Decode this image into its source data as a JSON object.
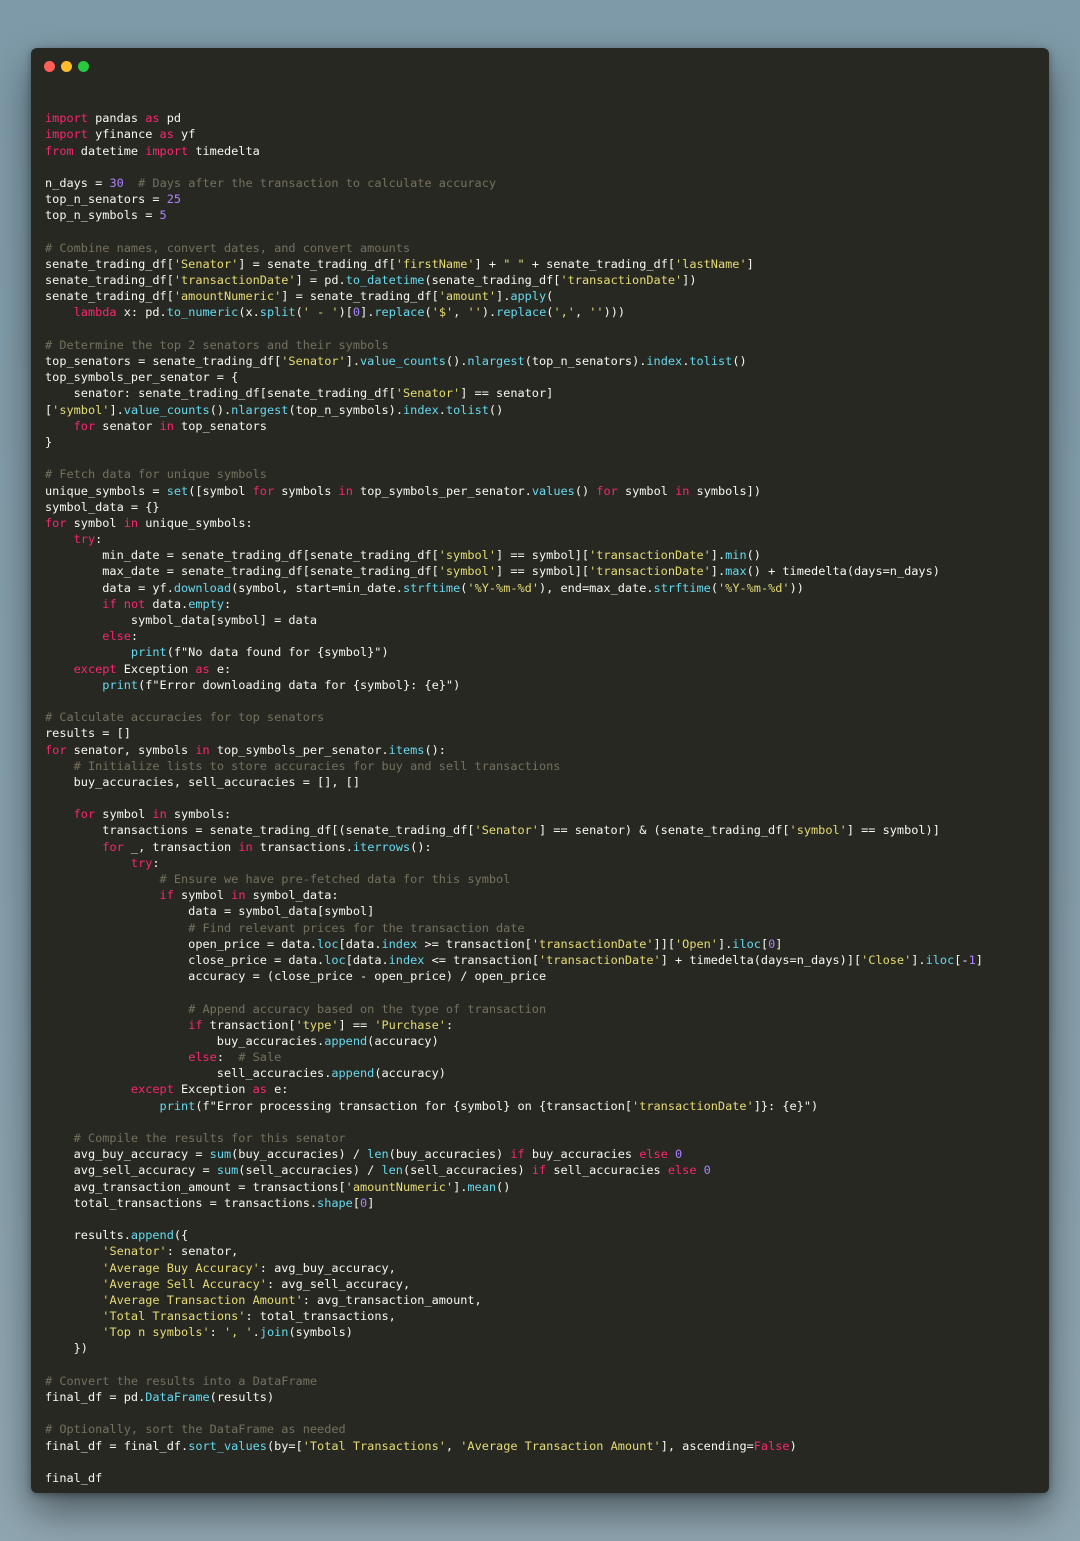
{
  "window": {
    "buttons": [
      {
        "name": "close-window-button",
        "color": "#ff5f56"
      },
      {
        "name": "minimize-window-button",
        "color": "#ffbd2e"
      },
      {
        "name": "maximize-window-button",
        "color": "#27c93f"
      }
    ]
  },
  "theme": {
    "background": "#272822",
    "text": "#f8f8f2",
    "keyword": "#f92672",
    "function": "#66d9ef",
    "string": "#e6db74",
    "number": "#ae81ff",
    "comment": "#75715e"
  },
  "code_lines": [
    [],
    [
      [
        "kw",
        "import"
      ],
      [
        "tx",
        " pandas "
      ],
      [
        "kw",
        "as"
      ],
      [
        "tx",
        " pd"
      ]
    ],
    [
      [
        "kw",
        "import"
      ],
      [
        "tx",
        " yfinance "
      ],
      [
        "kw",
        "as"
      ],
      [
        "tx",
        " yf"
      ]
    ],
    [
      [
        "kw",
        "from"
      ],
      [
        "tx",
        " datetime "
      ],
      [
        "kw",
        "import"
      ],
      [
        "tx",
        " timedelta"
      ]
    ],
    [],
    [
      [
        "tx",
        "n_days = "
      ],
      [
        "nm",
        "30"
      ],
      [
        "tx",
        "  "
      ],
      [
        "cm",
        "# Days after the transaction to calculate accuracy"
      ]
    ],
    [
      [
        "tx",
        "top_n_senators = "
      ],
      [
        "nm",
        "25"
      ]
    ],
    [
      [
        "tx",
        "top_n_symbols = "
      ],
      [
        "nm",
        "5"
      ]
    ],
    [],
    [
      [
        "cm",
        "# Combine names, convert dates, and convert amounts"
      ]
    ],
    [
      [
        "tx",
        "senate_trading_df["
      ],
      [
        "st",
        "'Senator'"
      ],
      [
        "tx",
        "] = senate_trading_df["
      ],
      [
        "st",
        "'firstName'"
      ],
      [
        "tx",
        "] + "
      ],
      [
        "st",
        "\" \""
      ],
      [
        "tx",
        " + senate_trading_df["
      ],
      [
        "st",
        "'lastName'"
      ],
      [
        "tx",
        "]"
      ]
    ],
    [
      [
        "tx",
        "senate_trading_df["
      ],
      [
        "st",
        "'transactionDate'"
      ],
      [
        "tx",
        "] = pd."
      ],
      [
        "fn",
        "to_datetime"
      ],
      [
        "tx",
        "(senate_trading_df["
      ],
      [
        "st",
        "'transactionDate'"
      ],
      [
        "tx",
        "])"
      ]
    ],
    [
      [
        "tx",
        "senate_trading_df["
      ],
      [
        "st",
        "'amountNumeric'"
      ],
      [
        "tx",
        "] = senate_trading_df["
      ],
      [
        "st",
        "'amount'"
      ],
      [
        "tx",
        "]."
      ],
      [
        "fn",
        "apply"
      ],
      [
        "tx",
        "("
      ]
    ],
    [
      [
        "tx",
        "    "
      ],
      [
        "kw",
        "lambda"
      ],
      [
        "tx",
        " x: pd."
      ],
      [
        "fn",
        "to_numeric"
      ],
      [
        "tx",
        "(x."
      ],
      [
        "fn",
        "split"
      ],
      [
        "tx",
        "("
      ],
      [
        "st",
        "' - '"
      ],
      [
        "tx",
        ")["
      ],
      [
        "nm",
        "0"
      ],
      [
        "tx",
        "]."
      ],
      [
        "fn",
        "replace"
      ],
      [
        "tx",
        "("
      ],
      [
        "st",
        "'$'"
      ],
      [
        "tx",
        ", "
      ],
      [
        "st",
        "''"
      ],
      [
        "tx",
        ")."
      ],
      [
        "fn",
        "replace"
      ],
      [
        "tx",
        "("
      ],
      [
        "st",
        "','"
      ],
      [
        "tx",
        ", "
      ],
      [
        "st",
        "''"
      ],
      [
        "tx",
        ")))"
      ]
    ],
    [],
    [
      [
        "cm",
        "# Determine the top 2 senators and their symbols"
      ]
    ],
    [
      [
        "tx",
        "top_senators = senate_trading_df["
      ],
      [
        "st",
        "'Senator'"
      ],
      [
        "tx",
        "]."
      ],
      [
        "fn",
        "value_counts"
      ],
      [
        "tx",
        "()."
      ],
      [
        "fn",
        "nlargest"
      ],
      [
        "tx",
        "(top_n_senators)."
      ],
      [
        "fn",
        "index"
      ],
      [
        "tx",
        "."
      ],
      [
        "fn",
        "tolist"
      ],
      [
        "tx",
        "()"
      ]
    ],
    [
      [
        "tx",
        "top_symbols_per_senator = {"
      ]
    ],
    [
      [
        "tx",
        "    senator: senate_trading_df[senate_trading_df["
      ],
      [
        "st",
        "'Senator'"
      ],
      [
        "tx",
        "] == senator]"
      ]
    ],
    [
      [
        "tx",
        "["
      ],
      [
        "st",
        "'symbol'"
      ],
      [
        "tx",
        "]."
      ],
      [
        "fn",
        "value_counts"
      ],
      [
        "tx",
        "()."
      ],
      [
        "fn",
        "nlargest"
      ],
      [
        "tx",
        "(top_n_symbols)."
      ],
      [
        "fn",
        "index"
      ],
      [
        "tx",
        "."
      ],
      [
        "fn",
        "tolist"
      ],
      [
        "tx",
        "()"
      ]
    ],
    [
      [
        "tx",
        "    "
      ],
      [
        "kw",
        "for"
      ],
      [
        "tx",
        " senator "
      ],
      [
        "kw",
        "in"
      ],
      [
        "tx",
        " top_senators"
      ]
    ],
    [
      [
        "tx",
        "}"
      ]
    ],
    [],
    [
      [
        "cm",
        "# Fetch data for unique symbols"
      ]
    ],
    [
      [
        "tx",
        "unique_symbols = "
      ],
      [
        "fn",
        "set"
      ],
      [
        "tx",
        "([symbol "
      ],
      [
        "kw",
        "for"
      ],
      [
        "tx",
        " symbols "
      ],
      [
        "kw",
        "in"
      ],
      [
        "tx",
        " top_symbols_per_senator."
      ],
      [
        "fn",
        "values"
      ],
      [
        "tx",
        "() "
      ],
      [
        "kw",
        "for"
      ],
      [
        "tx",
        " symbol "
      ],
      [
        "kw",
        "in"
      ],
      [
        "tx",
        " symbols])"
      ]
    ],
    [
      [
        "tx",
        "symbol_data = {}"
      ]
    ],
    [
      [
        "kw",
        "for"
      ],
      [
        "tx",
        " symbol "
      ],
      [
        "kw",
        "in"
      ],
      [
        "tx",
        " unique_symbols:"
      ]
    ],
    [
      [
        "tx",
        "    "
      ],
      [
        "kw",
        "try"
      ],
      [
        "tx",
        ":"
      ]
    ],
    [
      [
        "tx",
        "        min_date = senate_trading_df[senate_trading_df["
      ],
      [
        "st",
        "'symbol'"
      ],
      [
        "tx",
        "] == symbol]["
      ],
      [
        "st",
        "'transactionDate'"
      ],
      [
        "tx",
        "]."
      ],
      [
        "fn",
        "min"
      ],
      [
        "tx",
        "()"
      ]
    ],
    [
      [
        "tx",
        "        max_date = senate_trading_df[senate_trading_df["
      ],
      [
        "st",
        "'symbol'"
      ],
      [
        "tx",
        "] == symbol]["
      ],
      [
        "st",
        "'transactionDate'"
      ],
      [
        "tx",
        "]."
      ],
      [
        "fn",
        "max"
      ],
      [
        "tx",
        "() + timedelta(days=n_days)"
      ]
    ],
    [
      [
        "tx",
        "        data = yf."
      ],
      [
        "fn",
        "download"
      ],
      [
        "tx",
        "(symbol, start=min_date."
      ],
      [
        "fn",
        "strftime"
      ],
      [
        "tx",
        "("
      ],
      [
        "st",
        "'%Y-%m-%d'"
      ],
      [
        "tx",
        "), end=max_date."
      ],
      [
        "fn",
        "strftime"
      ],
      [
        "tx",
        "("
      ],
      [
        "st",
        "'%Y-%m-%d'"
      ],
      [
        "tx",
        "))"
      ]
    ],
    [
      [
        "tx",
        "        "
      ],
      [
        "kw",
        "if"
      ],
      [
        "tx",
        " "
      ],
      [
        "kw",
        "not"
      ],
      [
        "tx",
        " data."
      ],
      [
        "fn",
        "empty"
      ],
      [
        "tx",
        ":"
      ]
    ],
    [
      [
        "tx",
        "            symbol_data[symbol] = data"
      ]
    ],
    [
      [
        "tx",
        "        "
      ],
      [
        "kw",
        "else"
      ],
      [
        "tx",
        ":"
      ]
    ],
    [
      [
        "tx",
        "            "
      ],
      [
        "fn",
        "print"
      ],
      [
        "tx",
        "(f\"No data found for {symbol}\")"
      ]
    ],
    [
      [
        "tx",
        "    "
      ],
      [
        "kw",
        "except"
      ],
      [
        "tx",
        " Exception "
      ],
      [
        "kw",
        "as"
      ],
      [
        "tx",
        " e:"
      ]
    ],
    [
      [
        "tx",
        "        "
      ],
      [
        "fn",
        "print"
      ],
      [
        "tx",
        "(f\"Error downloading data for {symbol}: {e}\")"
      ]
    ],
    [],
    [
      [
        "cm",
        "# Calculate accuracies for top senators"
      ]
    ],
    [
      [
        "tx",
        "results = []"
      ]
    ],
    [
      [
        "kw",
        "for"
      ],
      [
        "tx",
        " senator, symbols "
      ],
      [
        "kw",
        "in"
      ],
      [
        "tx",
        " top_symbols_per_senator."
      ],
      [
        "fn",
        "items"
      ],
      [
        "tx",
        "():"
      ]
    ],
    [
      [
        "tx",
        "    "
      ],
      [
        "cm",
        "# Initialize lists to store accuracies for buy and sell transactions"
      ]
    ],
    [
      [
        "tx",
        "    buy_accuracies, sell_accuracies = [], []"
      ]
    ],
    [],
    [
      [
        "tx",
        "    "
      ],
      [
        "kw",
        "for"
      ],
      [
        "tx",
        " symbol "
      ],
      [
        "kw",
        "in"
      ],
      [
        "tx",
        " symbols:"
      ]
    ],
    [
      [
        "tx",
        "        transactions = senate_trading_df[(senate_trading_df["
      ],
      [
        "st",
        "'Senator'"
      ],
      [
        "tx",
        "] == senator) & (senate_trading_df["
      ],
      [
        "st",
        "'symbol'"
      ],
      [
        "tx",
        "] == symbol)]"
      ]
    ],
    [
      [
        "tx",
        "        "
      ],
      [
        "kw",
        "for"
      ],
      [
        "tx",
        " _, transaction "
      ],
      [
        "kw",
        "in"
      ],
      [
        "tx",
        " transactions."
      ],
      [
        "fn",
        "iterrows"
      ],
      [
        "tx",
        "():"
      ]
    ],
    [
      [
        "tx",
        "            "
      ],
      [
        "kw",
        "try"
      ],
      [
        "tx",
        ":"
      ]
    ],
    [
      [
        "tx",
        "                "
      ],
      [
        "cm",
        "# Ensure we have pre-fetched data for this symbol"
      ]
    ],
    [
      [
        "tx",
        "                "
      ],
      [
        "kw",
        "if"
      ],
      [
        "tx",
        " symbol "
      ],
      [
        "kw",
        "in"
      ],
      [
        "tx",
        " symbol_data:"
      ]
    ],
    [
      [
        "tx",
        "                    data = symbol_data[symbol]"
      ]
    ],
    [
      [
        "tx",
        "                    "
      ],
      [
        "cm",
        "# Find relevant prices for the transaction date"
      ]
    ],
    [
      [
        "tx",
        "                    open_price = data."
      ],
      [
        "fn",
        "loc"
      ],
      [
        "tx",
        "[data."
      ],
      [
        "fn",
        "index"
      ],
      [
        "tx",
        " >= transaction["
      ],
      [
        "st",
        "'transactionDate'"
      ],
      [
        "tx",
        "]]["
      ],
      [
        "st",
        "'Open'"
      ],
      [
        "tx",
        "]."
      ],
      [
        "fn",
        "iloc"
      ],
      [
        "tx",
        "["
      ],
      [
        "nm",
        "0"
      ],
      [
        "tx",
        "]"
      ]
    ],
    [
      [
        "tx",
        "                    close_price = data."
      ],
      [
        "fn",
        "loc"
      ],
      [
        "tx",
        "[data."
      ],
      [
        "fn",
        "index"
      ],
      [
        "tx",
        " <= transaction["
      ],
      [
        "st",
        "'transactionDate'"
      ],
      [
        "tx",
        "] + timedelta(days=n_days)]["
      ],
      [
        "st",
        "'Close'"
      ],
      [
        "tx",
        "]."
      ],
      [
        "fn",
        "iloc"
      ],
      [
        "tx",
        "[-"
      ],
      [
        "nm",
        "1"
      ],
      [
        "tx",
        "]"
      ]
    ],
    [
      [
        "tx",
        "                    accuracy = (close_price - open_price) / open_price"
      ]
    ],
    [],
    [
      [
        "tx",
        "                    "
      ],
      [
        "cm",
        "# Append accuracy based on the type of transaction"
      ]
    ],
    [
      [
        "tx",
        "                    "
      ],
      [
        "kw",
        "if"
      ],
      [
        "tx",
        " transaction["
      ],
      [
        "st",
        "'type'"
      ],
      [
        "tx",
        "] == "
      ],
      [
        "st",
        "'Purchase'"
      ],
      [
        "tx",
        ":"
      ]
    ],
    [
      [
        "tx",
        "                        buy_accuracies."
      ],
      [
        "fn",
        "append"
      ],
      [
        "tx",
        "(accuracy)"
      ]
    ],
    [
      [
        "tx",
        "                    "
      ],
      [
        "kw",
        "else"
      ],
      [
        "tx",
        ":  "
      ],
      [
        "cm",
        "# Sale"
      ]
    ],
    [
      [
        "tx",
        "                        sell_accuracies."
      ],
      [
        "fn",
        "append"
      ],
      [
        "tx",
        "(accuracy)"
      ]
    ],
    [
      [
        "tx",
        "            "
      ],
      [
        "kw",
        "except"
      ],
      [
        "tx",
        " Exception "
      ],
      [
        "kw",
        "as"
      ],
      [
        "tx",
        " e:"
      ]
    ],
    [
      [
        "tx",
        "                "
      ],
      [
        "fn",
        "print"
      ],
      [
        "tx",
        "(f\"Error processing transaction for {symbol} on {transaction["
      ],
      [
        "st",
        "'transactionDate'"
      ],
      [
        "tx",
        "]}: {e}\")"
      ]
    ],
    [],
    [
      [
        "tx",
        "    "
      ],
      [
        "cm",
        "# Compile the results for this senator"
      ]
    ],
    [
      [
        "tx",
        "    avg_buy_accuracy = "
      ],
      [
        "fn",
        "sum"
      ],
      [
        "tx",
        "(buy_accuracies) / "
      ],
      [
        "fn",
        "len"
      ],
      [
        "tx",
        "(buy_accuracies) "
      ],
      [
        "kw",
        "if"
      ],
      [
        "tx",
        " buy_accuracies "
      ],
      [
        "kw",
        "else"
      ],
      [
        "tx",
        " "
      ],
      [
        "nm",
        "0"
      ]
    ],
    [
      [
        "tx",
        "    avg_sell_accuracy = "
      ],
      [
        "fn",
        "sum"
      ],
      [
        "tx",
        "(sell_accuracies) / "
      ],
      [
        "fn",
        "len"
      ],
      [
        "tx",
        "(sell_accuracies) "
      ],
      [
        "kw",
        "if"
      ],
      [
        "tx",
        " sell_accuracies "
      ],
      [
        "kw",
        "else"
      ],
      [
        "tx",
        " "
      ],
      [
        "nm",
        "0"
      ]
    ],
    [
      [
        "tx",
        "    avg_transaction_amount = transactions["
      ],
      [
        "st",
        "'amountNumeric'"
      ],
      [
        "tx",
        "]."
      ],
      [
        "fn",
        "mean"
      ],
      [
        "tx",
        "()"
      ]
    ],
    [
      [
        "tx",
        "    total_transactions = transactions."
      ],
      [
        "fn",
        "shape"
      ],
      [
        "tx",
        "["
      ],
      [
        "nm",
        "0"
      ],
      [
        "tx",
        "]"
      ]
    ],
    [],
    [
      [
        "tx",
        "    results."
      ],
      [
        "fn",
        "append"
      ],
      [
        "tx",
        "({"
      ]
    ],
    [
      [
        "tx",
        "        "
      ],
      [
        "st",
        "'Senator'"
      ],
      [
        "tx",
        ": senator,"
      ]
    ],
    [
      [
        "tx",
        "        "
      ],
      [
        "st",
        "'Average Buy Accuracy'"
      ],
      [
        "tx",
        ": avg_buy_accuracy,"
      ]
    ],
    [
      [
        "tx",
        "        "
      ],
      [
        "st",
        "'Average Sell Accuracy'"
      ],
      [
        "tx",
        ": avg_sell_accuracy,"
      ]
    ],
    [
      [
        "tx",
        "        "
      ],
      [
        "st",
        "'Average Transaction Amount'"
      ],
      [
        "tx",
        ": avg_transaction_amount,"
      ]
    ],
    [
      [
        "tx",
        "        "
      ],
      [
        "st",
        "'Total Transactions'"
      ],
      [
        "tx",
        ": total_transactions,"
      ]
    ],
    [
      [
        "tx",
        "        "
      ],
      [
        "st",
        "'Top n symbols'"
      ],
      [
        "tx",
        ": "
      ],
      [
        "st",
        "', '"
      ],
      [
        "tx",
        "."
      ],
      [
        "fn",
        "join"
      ],
      [
        "tx",
        "(symbols)"
      ]
    ],
    [
      [
        "tx",
        "    })"
      ]
    ],
    [],
    [
      [
        "cm",
        "# Convert the results into a DataFrame"
      ]
    ],
    [
      [
        "tx",
        "final_df = pd."
      ],
      [
        "fn",
        "DataFrame"
      ],
      [
        "tx",
        "(results)"
      ]
    ],
    [],
    [
      [
        "cm",
        "# Optionally, sort the DataFrame as needed"
      ]
    ],
    [
      [
        "tx",
        "final_df = final_df."
      ],
      [
        "fn",
        "sort_values"
      ],
      [
        "tx",
        "(by=["
      ],
      [
        "st",
        "'Total Transactions'"
      ],
      [
        "tx",
        ", "
      ],
      [
        "st",
        "'Average Transaction Amount'"
      ],
      [
        "tx",
        "], ascending="
      ],
      [
        "kw",
        "False"
      ],
      [
        "tx",
        ")"
      ]
    ],
    [],
    [
      [
        "tx",
        "final_df"
      ]
    ]
  ]
}
